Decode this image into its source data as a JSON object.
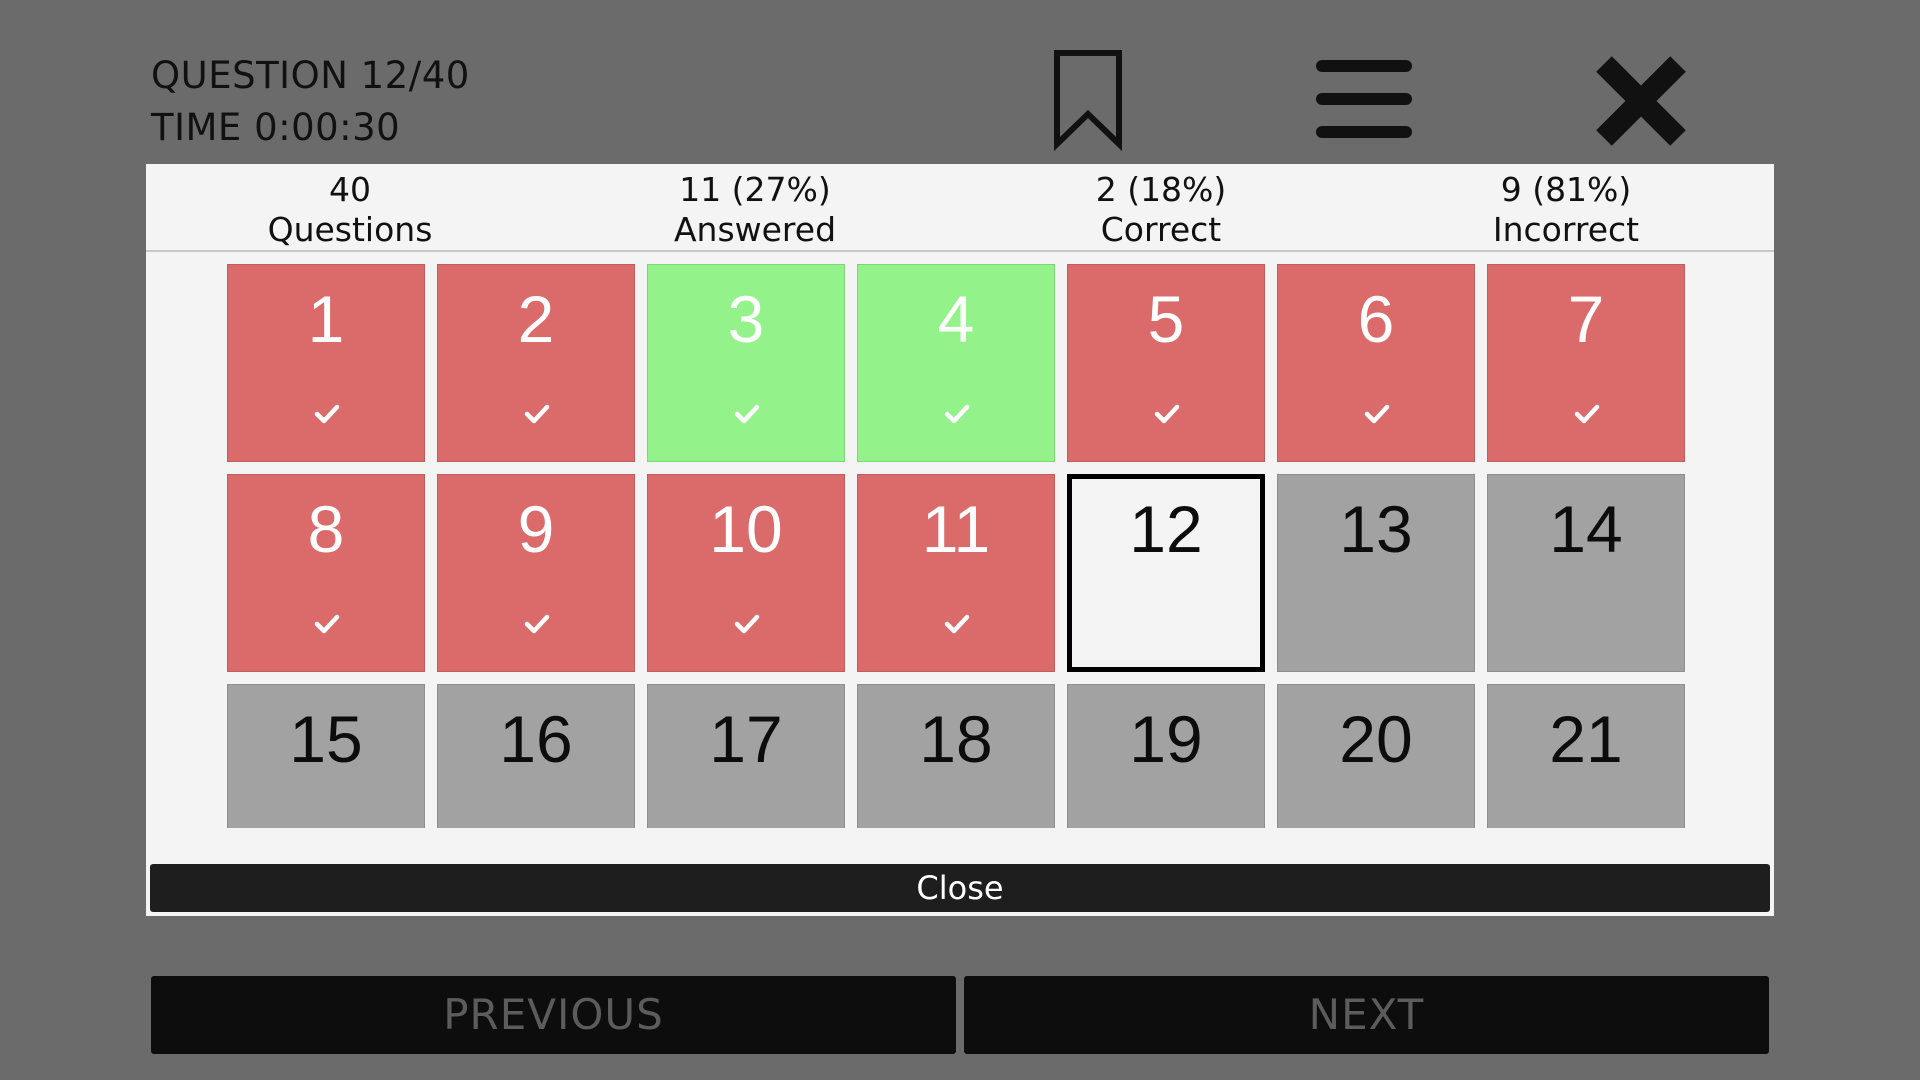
{
  "header": {
    "question_label": "QUESTION 12/40",
    "time_label": "TIME 0:00:30"
  },
  "icons": {
    "bookmark": "bookmark-icon",
    "menu": "hamburger-menu-icon",
    "close": "close-icon",
    "check": "check-icon"
  },
  "stats": [
    {
      "value": "40",
      "label": "Questions"
    },
    {
      "value": "11 (27%)",
      "label": "Answered"
    },
    {
      "value": "2 (18%)",
      "label": "Correct"
    },
    {
      "value": "9 (81%)",
      "label": "Incorrect"
    }
  ],
  "questions": [
    {
      "num": "1",
      "status": "incorrect",
      "checked": true
    },
    {
      "num": "2",
      "status": "incorrect",
      "checked": true
    },
    {
      "num": "3",
      "status": "correct",
      "checked": true
    },
    {
      "num": "4",
      "status": "correct",
      "checked": true
    },
    {
      "num": "5",
      "status": "incorrect",
      "checked": true
    },
    {
      "num": "6",
      "status": "incorrect",
      "checked": true
    },
    {
      "num": "7",
      "status": "incorrect",
      "checked": true
    },
    {
      "num": "8",
      "status": "incorrect",
      "checked": true
    },
    {
      "num": "9",
      "status": "incorrect",
      "checked": true
    },
    {
      "num": "10",
      "status": "incorrect",
      "checked": true
    },
    {
      "num": "11",
      "status": "incorrect",
      "checked": true
    },
    {
      "num": "12",
      "status": "current",
      "checked": false
    },
    {
      "num": "13",
      "status": "unanswered",
      "checked": false
    },
    {
      "num": "14",
      "status": "unanswered",
      "checked": false
    },
    {
      "num": "15",
      "status": "unanswered",
      "checked": false
    },
    {
      "num": "16",
      "status": "unanswered",
      "checked": false
    },
    {
      "num": "17",
      "status": "unanswered",
      "checked": false
    },
    {
      "num": "18",
      "status": "unanswered",
      "checked": false
    },
    {
      "num": "19",
      "status": "unanswered",
      "checked": false
    },
    {
      "num": "20",
      "status": "unanswered",
      "checked": false
    },
    {
      "num": "21",
      "status": "unanswered",
      "checked": false
    }
  ],
  "colors": {
    "background": "#6b6b6b",
    "incorrect": "#db6b6b",
    "correct": "#93f28a",
    "unanswered": "#a2a2a2",
    "panel": "#f4f4f4"
  },
  "close_label": "Close",
  "nav": {
    "previous_label": "PREVIOUS",
    "next_label": "NEXT"
  }
}
